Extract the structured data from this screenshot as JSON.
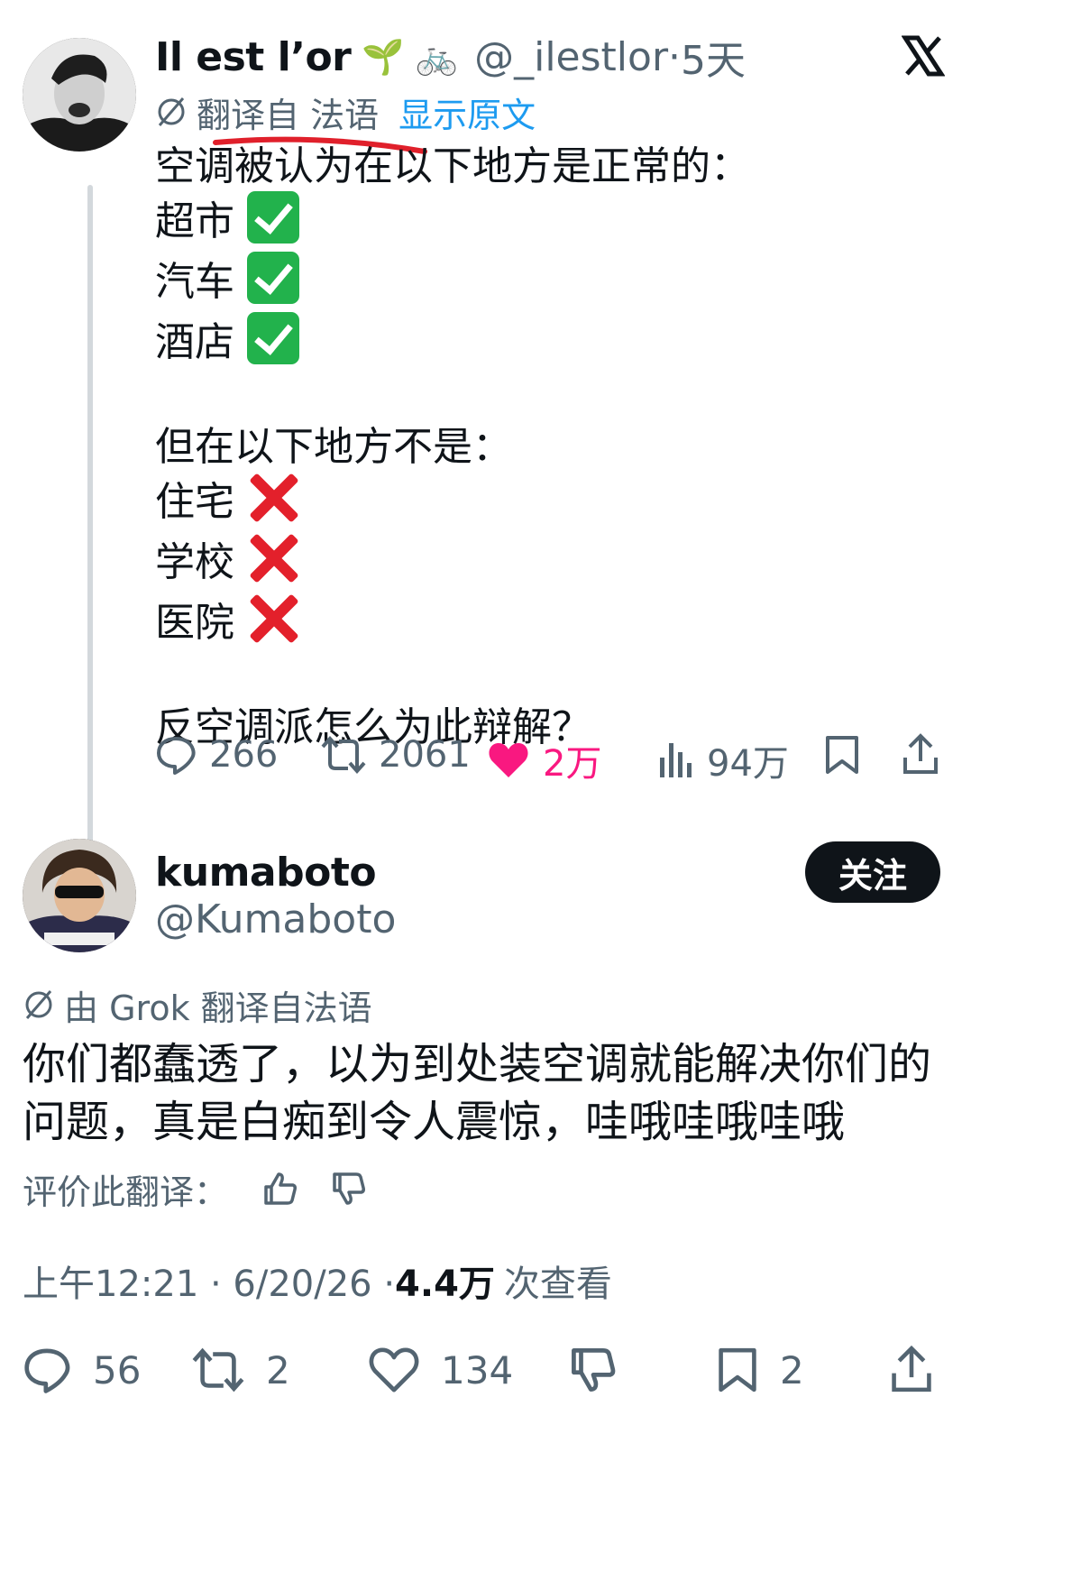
{
  "tweet": {
    "author_name": "Il est l’or",
    "author_emojis": "🌱 🚲",
    "handle": "@_ilestlor",
    "separator": "·",
    "time": "5天",
    "translated_from": "翻译自 法语",
    "show_original": "显示原文",
    "intro": "空调被认为在以下地方是正常的：",
    "yes_items": [
      "超市",
      "汽车",
      "酒店"
    ],
    "middle": "但在以下地方不是：",
    "no_items": [
      "住宅",
      "学校",
      "医院"
    ],
    "question": "反空调派怎么为此辩解？",
    "stats": {
      "replies": "266",
      "reposts": "2061",
      "likes": "2万",
      "views": "94万"
    }
  },
  "reply": {
    "author_name": "kumaboto",
    "handle": "@Kumaboto",
    "follow_label": "关注",
    "translated_by": "由 Grok 翻译自法语",
    "text_line1": "你们都蠢透了，以为到处装空调就能解决你们的",
    "text_line2": "问题，真是白痴到令人震惊，哇哦哇哦哇哦",
    "rate_translation": "评价此翻译：",
    "timestamp": "上午12:21 · 6/20/26 · ",
    "views_count": "4.4万",
    "views_label": "次查看",
    "stats": {
      "replies": "56",
      "reposts": "2",
      "likes": "134",
      "bookmarks": "2"
    }
  },
  "colors": {
    "accent_blue": "#1d9bf0",
    "like_pink": "#f91880",
    "underline_red": "#e0202b",
    "gray": "#536471"
  }
}
